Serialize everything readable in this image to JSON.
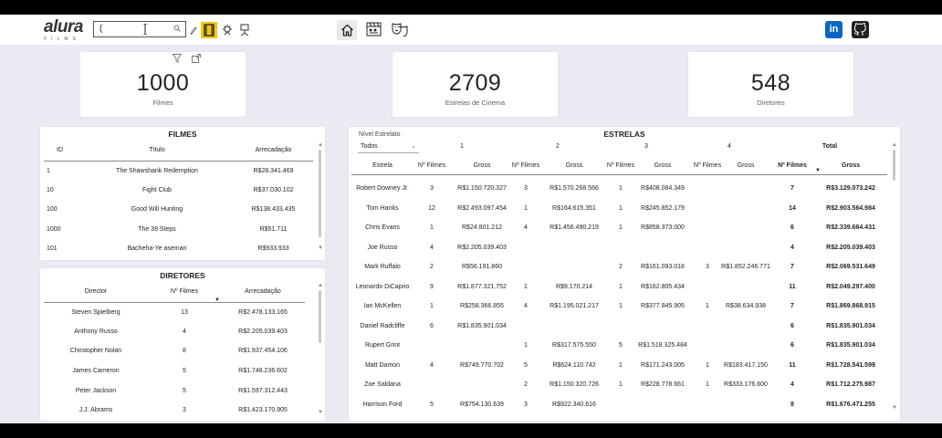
{
  "topbar": {
    "logo_word": "alura",
    "logo_sub": "FILMS",
    "search_value": "(",
    "icons": [
      "pencil-icon",
      "film-icon",
      "award-icon",
      "award-stand-icon",
      "home-icon",
      "clapperboard-icon",
      "theater-masks-icon",
      "linkedin-icon",
      "github-icon"
    ]
  },
  "kpis": [
    {
      "value": "1000",
      "label": "Filmes"
    },
    {
      "value": "2709",
      "label": "Estrelas de Cinema"
    },
    {
      "value": "548",
      "label": "Diretores"
    }
  ],
  "filmes": {
    "title": "FILMES",
    "headers": [
      "ID",
      "Título",
      "Arrecadação"
    ],
    "rows": [
      [
        "1",
        "The Shawshank Redemption",
        "R$28.341.469"
      ],
      [
        "10",
        "Fight Club",
        "R$37.030.102"
      ],
      [
        "100",
        "Good Will Hunting",
        "R$138.433.435"
      ],
      [
        "1000",
        "The 39 Steps",
        "R$51.711"
      ],
      [
        "101",
        "Bacheha-Ye aseman",
        "R$933.933"
      ]
    ]
  },
  "diretores": {
    "title": "DIRETORES",
    "headers": [
      "Director",
      "Nº Filmes",
      "Arrecadação"
    ],
    "rows": [
      [
        "Steven Spielberg",
        "13",
        "R$2.478.133.165"
      ],
      [
        "Anthony Russo",
        "4",
        "R$2.205.039.403"
      ],
      [
        "Christopher Nolan",
        "8",
        "R$1.937.454.106"
      ],
      [
        "James Cameron",
        "5",
        "R$1.748.236.602"
      ],
      [
        "Peter Jackson",
        "5",
        "R$1.597.312.443"
      ],
      [
        "J.J. Abrams",
        "3",
        "R$1.423.170.905"
      ]
    ]
  },
  "estrelas": {
    "title": "ESTRELAS",
    "level_label": "Nível Estrelato",
    "level_value": "Todos",
    "groups": [
      "1",
      "2",
      "3",
      "4",
      "Total"
    ],
    "sub_headers": [
      "Estrela",
      "Nº Filmes",
      "Gross",
      "Nº Filmes",
      "Gross",
      "Nº Filmes",
      "Gross",
      "Nº Filmes",
      "Gross",
      "Nº Filmes",
      "Gross"
    ],
    "rows": [
      [
        "Robert Downey Jr.",
        "3",
        "R$1.150.720.327",
        "3",
        "R$1.570.268.566",
        "1",
        "R$408.084.349",
        "",
        "",
        "7",
        "R$3.129.073.242"
      ],
      [
        "Tom Hanks",
        "12",
        "R$2.493.097.454",
        "1",
        "R$164.615.351",
        "1",
        "R$245.852.179",
        "",
        "",
        "14",
        "R$2.903.564.984"
      ],
      [
        "Chris Evans",
        "1",
        "R$24.801.212",
        "4",
        "R$1.456.490.219",
        "1",
        "R$858.373.000",
        "",
        "",
        "6",
        "R$2.339.664.431"
      ],
      [
        "Joe Russo",
        "4",
        "R$2.205.039.403",
        "",
        "",
        "",
        "",
        "",
        "",
        "4",
        "R$2.205.039.403"
      ],
      [
        "Mark Ruffalo",
        "2",
        "R$56.191.860",
        "",
        "",
        "2",
        "R$161.093.018",
        "3",
        "R$1.852.246.771",
        "7",
        "R$2.069.531.649"
      ],
      [
        "Leonardo DiCaprio",
        "9",
        "R$1.877.321.752",
        "1",
        "R$9.170.214",
        "1",
        "R$162.805.434",
        "",
        "",
        "11",
        "R$2.049.297.400"
      ],
      [
        "Ian McKellen",
        "1",
        "R$258.366.855",
        "4",
        "R$1.195.021.217",
        "1",
        "R$377.845.905",
        "1",
        "R$38.634.938",
        "7",
        "R$1.869.868.915"
      ],
      [
        "Daniel Radcliffe",
        "6",
        "R$1.835.901.034",
        "",
        "",
        "",
        "",
        "",
        "",
        "6",
        "R$1.835.901.034"
      ],
      [
        "Rupert Grint",
        "",
        "",
        "1",
        "R$317.575.550",
        "5",
        "R$1.518.325.484",
        "",
        "",
        "6",
        "R$1.835.901.034"
      ],
      [
        "Matt Damon",
        "4",
        "R$749.770.702",
        "5",
        "R$624.110.742",
        "1",
        "R$171.243.005",
        "1",
        "R$183.417.150",
        "11",
        "R$1.728.541.599"
      ],
      [
        "Zoe Saldana",
        "",
        "",
        "2",
        "R$1.150.320.726",
        "1",
        "R$228.778.661",
        "1",
        "R$333.176.600",
        "4",
        "R$1.712.275.987"
      ],
      [
        "Harrison Ford",
        "5",
        "R$754.130.639",
        "3",
        "R$922.340.616",
        "",
        "",
        "",
        "",
        "8",
        "R$1.676.471.255"
      ]
    ]
  },
  "colors": {
    "accent": "#f2c811",
    "linkedin": "#0a66c2",
    "canvas": "#eaeaf2"
  }
}
